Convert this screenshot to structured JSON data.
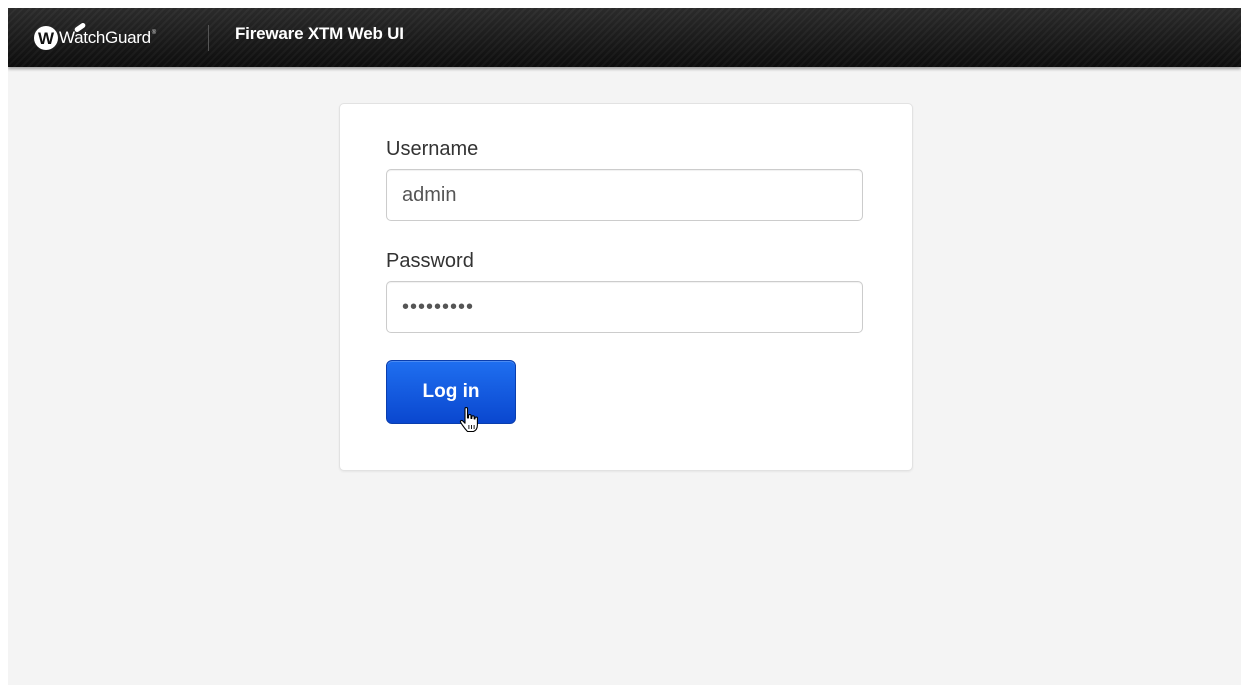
{
  "header": {
    "logo_text": "WatchGuard",
    "logo_letter": "W",
    "logo_tm": "®",
    "app_title": "Fireware XTM Web UI"
  },
  "login": {
    "username_label": "Username",
    "username_value": "admin",
    "password_label": "Password",
    "password_value": "•••••••••",
    "login_button_label": "Log in"
  },
  "colors": {
    "header_bg": "#1a1a1a",
    "page_bg": "#f4f4f4",
    "button_bg": "#0a47cf"
  },
  "icons": {
    "logo": "watchguard-logo-icon",
    "cursor": "hand-pointer-cursor-icon"
  }
}
